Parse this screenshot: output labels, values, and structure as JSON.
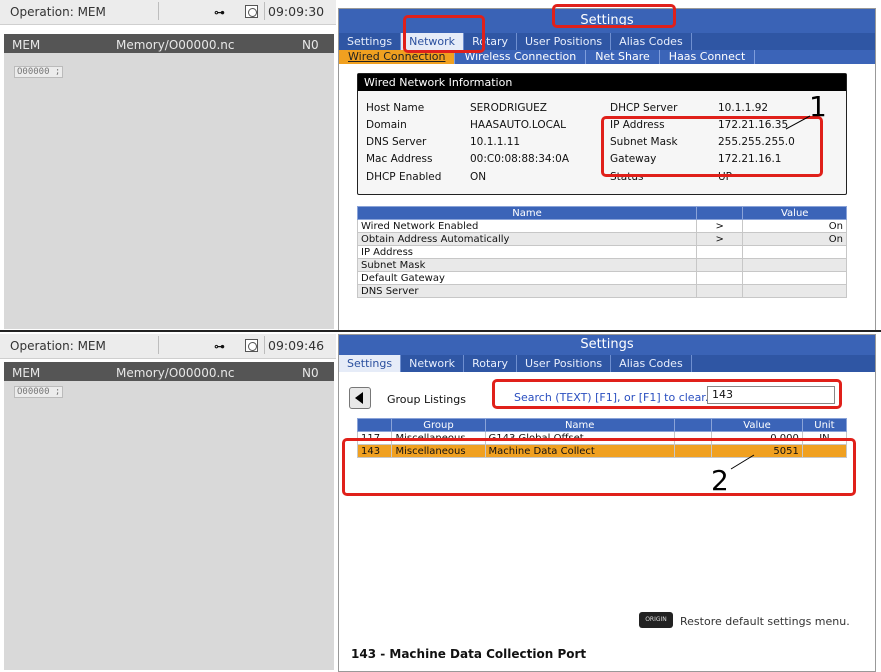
{
  "top": {
    "status": {
      "operation": "Operation: MEM",
      "time": "09:09:30"
    },
    "mem_header": {
      "mode": "MEM",
      "file": "Memory/O00000.nc",
      "n": "N0"
    },
    "program_line": "O00000 ;",
    "settings_title": "Settings",
    "tabs": [
      "Settings",
      "Network",
      "Rotary",
      "User Positions",
      "Alias Codes"
    ],
    "active_tab": "Network",
    "subtabs": [
      "Wired Connection",
      "Wireless Connection",
      "Net Share",
      "Haas Connect"
    ],
    "info": {
      "title": "Wired Network Information",
      "left": [
        {
          "label": "Host Name",
          "value": "SERODRIGUEZ"
        },
        {
          "label": "Domain",
          "value": "HAASAUTO.LOCAL"
        },
        {
          "label": "DNS Server",
          "value": "10.1.1.11"
        },
        {
          "label": "Mac Address",
          "value": "00:C0:08:88:34:0A"
        },
        {
          "label": "DHCP Enabled",
          "value": "ON"
        }
      ],
      "right": [
        {
          "label": "DHCP Server",
          "value": "10.1.1.92"
        },
        {
          "label": "IP Address",
          "value": "172.21.16.35"
        },
        {
          "label": "Subnet Mask",
          "value": "255.255.255.0"
        },
        {
          "label": "Gateway",
          "value": "172.21.16.1"
        },
        {
          "label": "Status",
          "value": "UP"
        }
      ]
    },
    "table": {
      "headers": [
        "Name",
        "Value"
      ],
      "rows": [
        {
          "name": "Wired Network Enabled",
          "arrow": ">",
          "value": "On"
        },
        {
          "name": "Obtain Address Automatically",
          "arrow": ">",
          "value": "On"
        },
        {
          "name": "IP Address",
          "arrow": "",
          "value": ""
        },
        {
          "name": "Subnet Mask",
          "arrow": "",
          "value": ""
        },
        {
          "name": "Default Gateway",
          "arrow": "",
          "value": ""
        },
        {
          "name": "DNS Server",
          "arrow": "",
          "value": ""
        }
      ]
    },
    "callout_label": "1"
  },
  "bottom": {
    "status": {
      "operation": "Operation: MEM",
      "time": "09:09:46"
    },
    "mem_header": {
      "mode": "MEM",
      "file": "Memory/O00000.nc",
      "n": "N0"
    },
    "program_line": "O00000 ;",
    "settings_title": "Settings",
    "tabs": [
      "Settings",
      "Network",
      "Rotary",
      "User Positions",
      "Alias Codes"
    ],
    "active_tab": "Settings",
    "group_listings": "Group Listings",
    "search_hint": "Search (TEXT) [F1], or [F1] to clear.",
    "search_value": "143",
    "table": {
      "headers": [
        "Group",
        "Name",
        "Value",
        "Unit"
      ],
      "rows": [
        {
          "num": "117",
          "group": "Miscellaneous",
          "name": "G143 Global Offset",
          "value": "0.000",
          "unit": "IN"
        },
        {
          "num": "143",
          "group": "Miscellaneous",
          "name": "Machine Data Collect",
          "value": "5051",
          "unit": ""
        }
      ]
    },
    "origin_key": "ORIGIN",
    "restore_text": "Restore default settings menu.",
    "footer_title": "143 - Machine Data Collection Port",
    "callout_label": "2"
  },
  "colors": {
    "accent_blue": "#3b64b8",
    "highlight_orange": "#f0a020",
    "callout_red": "#e0201a"
  }
}
